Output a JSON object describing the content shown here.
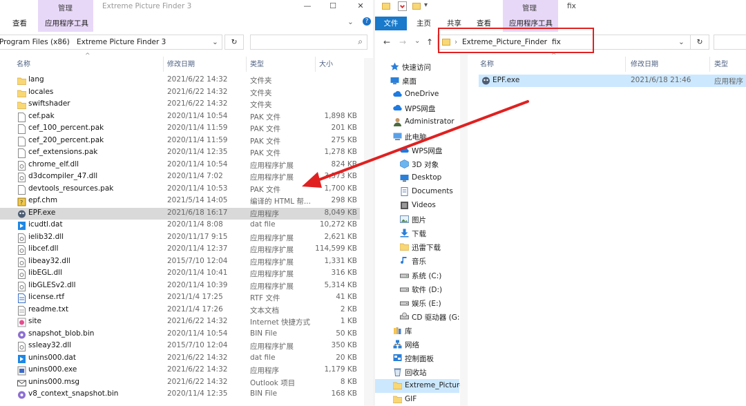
{
  "left_window": {
    "title": "Extreme Picture Finder 3",
    "context_tab_group": "管理",
    "ribbon_tabs": [
      "查看",
      "应用程序工具"
    ],
    "controls": {
      "minimize": "—",
      "maximize": "☐",
      "close": "✕",
      "chevron": "⌄",
      "help": "?"
    },
    "address": {
      "path": "Program Files (x86)",
      "sep": "›",
      "folder": "Extreme Picture Finder 3",
      "dropdown": "⌄",
      "refresh": "↻"
    },
    "search": {
      "icon": "⌕"
    },
    "columns": {
      "name": "名称",
      "date": "修改日期",
      "type": "类型",
      "size": "大小",
      "sort_arrow": "^"
    },
    "files": [
      {
        "icon": "folder",
        "name": "lang",
        "date": "2021/6/22 14:32",
        "type": "文件夹",
        "size": ""
      },
      {
        "icon": "folder",
        "name": "locales",
        "date": "2021/6/22 14:32",
        "type": "文件夹",
        "size": ""
      },
      {
        "icon": "folder",
        "name": "swiftshader",
        "date": "2021/6/22 14:32",
        "type": "文件夹",
        "size": ""
      },
      {
        "icon": "file",
        "name": "cef.pak",
        "date": "2020/11/4 10:54",
        "type": "PAK 文件",
        "size": "1,898 KB"
      },
      {
        "icon": "file",
        "name": "cef_100_percent.pak",
        "date": "2020/11/4 11:59",
        "type": "PAK 文件",
        "size": "201 KB"
      },
      {
        "icon": "file",
        "name": "cef_200_percent.pak",
        "date": "2020/11/4 11:59",
        "type": "PAK 文件",
        "size": "275 KB"
      },
      {
        "icon": "file",
        "name": "cef_extensions.pak",
        "date": "2020/11/4 12:35",
        "type": "PAK 文件",
        "size": "1,278 KB"
      },
      {
        "icon": "dll",
        "name": "chrome_elf.dll",
        "date": "2020/11/4 10:54",
        "type": "应用程序扩展",
        "size": "824 KB"
      },
      {
        "icon": "dll",
        "name": "d3dcompiler_47.dll",
        "date": "2020/11/4 7:02",
        "type": "应用程序扩展",
        "size": "3,573 KB"
      },
      {
        "icon": "file",
        "name": "devtools_resources.pak",
        "date": "2020/11/4 10:53",
        "type": "PAK 文件",
        "size": "1,700 KB"
      },
      {
        "icon": "chm",
        "name": "epf.chm",
        "date": "2021/5/14 14:05",
        "type": "编译的 HTML 帮...",
        "size": "298 KB"
      },
      {
        "icon": "exe",
        "name": "EPF.exe",
        "date": "2021/6/18 16:17",
        "type": "应用程序",
        "size": "8,049 KB",
        "selected": true
      },
      {
        "icon": "dat",
        "name": "icudtl.dat",
        "date": "2020/11/4 8:08",
        "type": "dat file",
        "size": "10,272 KB"
      },
      {
        "icon": "dll",
        "name": "ielib32.dll",
        "date": "2020/11/17 9:15",
        "type": "应用程序扩展",
        "size": "2,621 KB"
      },
      {
        "icon": "dll",
        "name": "libcef.dll",
        "date": "2020/11/4 12:37",
        "type": "应用程序扩展",
        "size": "114,599 KB"
      },
      {
        "icon": "dll",
        "name": "libeay32.dll",
        "date": "2015/7/10 12:04",
        "type": "应用程序扩展",
        "size": "1,331 KB"
      },
      {
        "icon": "dll",
        "name": "libEGL.dll",
        "date": "2020/11/4 10:41",
        "type": "应用程序扩展",
        "size": "316 KB"
      },
      {
        "icon": "dll",
        "name": "libGLESv2.dll",
        "date": "2020/11/4 10:39",
        "type": "应用程序扩展",
        "size": "5,314 KB"
      },
      {
        "icon": "rtf",
        "name": "license.rtf",
        "date": "2021/1/4 17:25",
        "type": "RTF 文件",
        "size": "41 KB"
      },
      {
        "icon": "txt",
        "name": "readme.txt",
        "date": "2021/1/4 17:26",
        "type": "文本文档",
        "size": "2 KB"
      },
      {
        "icon": "url",
        "name": "site",
        "date": "2021/6/22 14:32",
        "type": "Internet 快捷方式",
        "size": "1 KB"
      },
      {
        "icon": "bin",
        "name": "snapshot_blob.bin",
        "date": "2020/11/4 10:54",
        "type": "BIN File",
        "size": "50 KB"
      },
      {
        "icon": "dll",
        "name": "ssleay32.dll",
        "date": "2015/7/10 12:04",
        "type": "应用程序扩展",
        "size": "350 KB"
      },
      {
        "icon": "dat",
        "name": "unins000.dat",
        "date": "2021/6/22 14:32",
        "type": "dat file",
        "size": "20 KB"
      },
      {
        "icon": "uninst",
        "name": "unins000.exe",
        "date": "2021/6/22 14:32",
        "type": "应用程序",
        "size": "1,179 KB"
      },
      {
        "icon": "msg",
        "name": "unins000.msg",
        "date": "2021/6/22 14:32",
        "type": "Outlook 项目",
        "size": "8 KB"
      },
      {
        "icon": "bin",
        "name": "v8_context_snapshot.bin",
        "date": "2020/11/4 12:35",
        "type": "BIN File",
        "size": "168 KB"
      }
    ]
  },
  "right_window": {
    "title": "fix",
    "context_tab_group": "管理",
    "quick_access_glyph": "▾",
    "ribbon_tabs": [
      "文件",
      "主页",
      "共享",
      "查看",
      "应用程序工具"
    ],
    "nav_buttons": {
      "back": "←",
      "forward": "→",
      "recent": "⌄",
      "up": "↑"
    },
    "address": {
      "sep": "›",
      "folder": "Extreme_Picture_Finder",
      "subfolder": "fix",
      "dropdown": "⌄",
      "refresh": "↻"
    },
    "columns": {
      "name": "名称",
      "date": "修改日期",
      "type": "类型",
      "sort_arrow": "^"
    },
    "files": [
      {
        "icon": "exe",
        "name": "EPF.exe",
        "date": "2021/6/18 21:46",
        "type": "应用程序"
      }
    ],
    "nav_pane": [
      {
        "label": "快速访问",
        "icon": "star",
        "level": 0
      },
      {
        "label": "桌面",
        "icon": "desktop",
        "level": 0
      },
      {
        "label": "OneDrive",
        "icon": "cloud",
        "level": 1
      },
      {
        "label": "WPS网盘",
        "icon": "cloud",
        "level": 1
      },
      {
        "label": "Administrator",
        "icon": "user",
        "level": 1
      },
      {
        "label": "此电脑",
        "icon": "pc",
        "level": 1
      },
      {
        "label": "WPS网盘",
        "icon": "cloud",
        "level": 2
      },
      {
        "label": "3D 对象",
        "icon": "cube",
        "level": 2
      },
      {
        "label": "Desktop",
        "icon": "desktop",
        "level": 2
      },
      {
        "label": "Documents",
        "icon": "doc",
        "level": 2
      },
      {
        "label": "Videos",
        "icon": "video",
        "level": 2
      },
      {
        "label": "图片",
        "icon": "picture",
        "level": 2
      },
      {
        "label": "下载",
        "icon": "download",
        "level": 2
      },
      {
        "label": "迅雷下载",
        "icon": "folder",
        "level": 2
      },
      {
        "label": "音乐",
        "icon": "music",
        "level": 2
      },
      {
        "label": "系统 (C:)",
        "icon": "drive",
        "level": 2
      },
      {
        "label": "软件 (D:)",
        "icon": "drive",
        "level": 2
      },
      {
        "label": "娱乐 (E:)",
        "icon": "drive",
        "level": 2
      },
      {
        "label": "CD 驱动器 (G:)",
        "icon": "cd",
        "level": 2
      },
      {
        "label": "库",
        "icon": "library",
        "level": 1
      },
      {
        "label": "网络",
        "icon": "network",
        "level": 1
      },
      {
        "label": "控制面板",
        "icon": "control",
        "level": 1
      },
      {
        "label": "回收站",
        "icon": "recycle",
        "level": 1
      },
      {
        "label": "Extreme_Picture",
        "icon": "folder",
        "level": 1,
        "selected": true
      },
      {
        "label": "GIF",
        "icon": "folder",
        "level": 1
      }
    ]
  },
  "colors": {
    "annotation_red": "#e02020",
    "selection_blue": "#cce8ff",
    "selection_gray": "#d9d9d9",
    "context_purple": "#e8d8f8",
    "file_tab_blue": "#1979ca",
    "folder_yellow": "#f8d775"
  }
}
